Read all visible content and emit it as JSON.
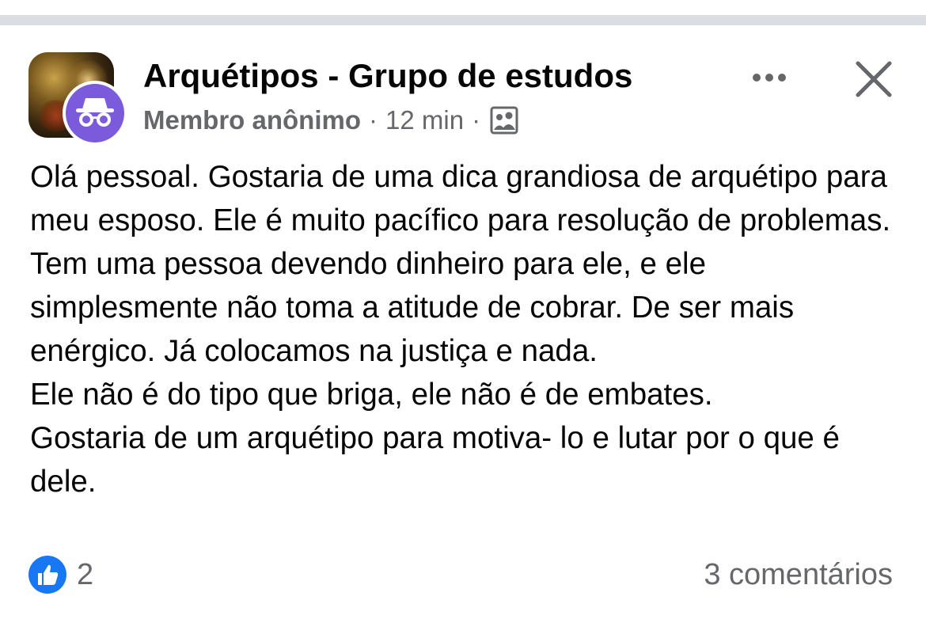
{
  "post": {
    "group_name": "Arquétipos - Grupo de estudos",
    "author": "Membro anônimo",
    "separator": "·",
    "time": "12 min",
    "audience_icon": "group-audience-icon",
    "more_icon": "more-options-icon",
    "close_icon": "close-icon",
    "body": "Olá pessoal. Gostaria de uma dica grandiosa de arquétipo para meu esposo. Ele é muito pacífico para resolução de problemas. Tem uma pessoa devendo dinheiro para ele, e ele simplesmente não toma a atitude de cobrar. De ser mais enérgico. Já colocamos na justiça e nada.\nEle não é do tipo que briga, ele não é de embates.\nGostaria de um arquétipo para motiva- lo e lutar por o que é dele.",
    "reaction_count": "2",
    "comments": "3 comentários"
  },
  "colors": {
    "accent": "#1877f2",
    "anonymous_badge": "#7b5bdc",
    "secondary_text": "#65676b",
    "divider": "#dadde1"
  }
}
